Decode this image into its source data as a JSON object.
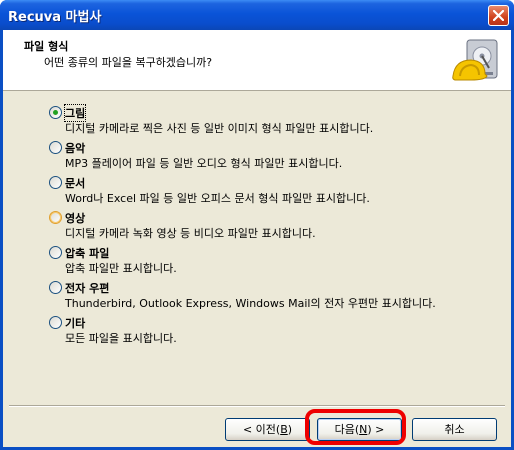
{
  "window": {
    "title": "Recuva 마법사"
  },
  "header": {
    "title": "파일 형식",
    "subtitle": "어떤 종류의 파일을 복구하겠습니까?",
    "icon": "hard-drive-with-hardhat-icon"
  },
  "options": [
    {
      "label": "그림",
      "description": "디지털 카메라로 찍은 사진 등 일반 이미지 형식 파일만 표시합니다.",
      "selected": true
    },
    {
      "label": "음악",
      "description": "MP3 플레이어 파일 등 일반 오디오 형식 파일만 표시합니다.",
      "selected": false
    },
    {
      "label": "문서",
      "description": "Word나 Excel 파일 등 일반 오피스 문서 형식 파일만 표시합니다.",
      "selected": false
    },
    {
      "label": "영상",
      "description": "디지털 카메라 녹화 영상 등 비디오 파일만 표시합니다.",
      "selected": false
    },
    {
      "label": "압축 파일",
      "description": "압축 파일만 표시합니다.",
      "selected": false
    },
    {
      "label": "전자 우편",
      "description": "Thunderbird, Outlook Express, Windows Mail의 전자 우편만 표시합니다.",
      "selected": false
    },
    {
      "label": "기타",
      "description": "모든 파일을 표시합니다.",
      "selected": false
    }
  ],
  "buttons": {
    "back": {
      "pre": "< 이전(",
      "key": "B",
      "post": ")"
    },
    "next": {
      "pre": "다음(",
      "key": "N",
      "post": ") >"
    },
    "cancel": "취소"
  },
  "colors": {
    "titlebar": "#0a54d8",
    "dialog_bg": "#ece9d8",
    "highlight": "#ee0000",
    "radio_selected": "#21a121"
  }
}
